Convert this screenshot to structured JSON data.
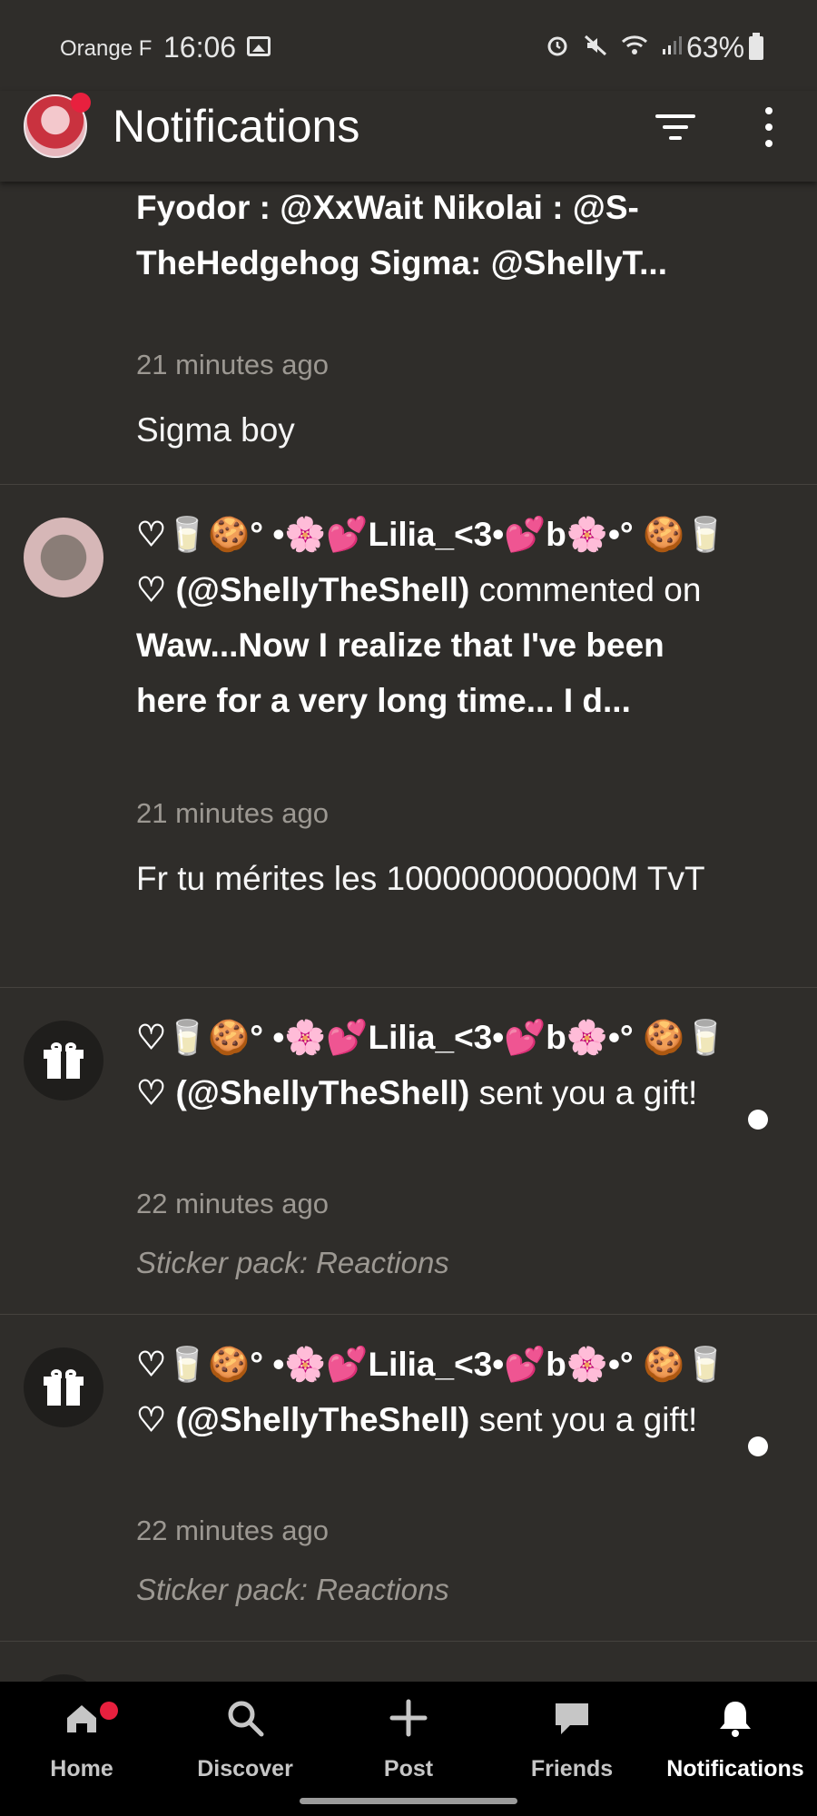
{
  "status_bar": {
    "carrier": "Orange F",
    "time": "16:06",
    "battery": "63%"
  },
  "header": {
    "title": "Notifications"
  },
  "notifications": [
    {
      "headline_bold": "Fyodor : @XxWait Nikolai : @S-TheHedgehog Sigma: @ShellyT...",
      "time": "21 minutes ago",
      "body": "Sigma boy"
    },
    {
      "user": "♡🥛🍪° •🌸💕Lilia_<3•💕b🌸•° 🍪🥛♡ (@ShellyTheShell)",
      "action": "commented on",
      "target": "Waw...Now I realize that I've been here for a very long time... I d...",
      "time": "21 minutes ago",
      "body": "Fr tu mérites les 100000000000M TvT"
    },
    {
      "user": "♡🥛🍪° •🌸💕Lilia_<3•💕b🌸•° 🍪🥛♡ (@ShellyTheShell)",
      "action": "sent you a gift!",
      "time": "22 minutes ago",
      "sticker": "Sticker pack: Reactions"
    },
    {
      "user": "♡🥛🍪° •🌸💕Lilia_<3•💕b🌸•° 🍪🥛♡ (@ShellyTheShell)",
      "action": "sent you a gift!",
      "time": "22 minutes ago",
      "sticker": "Sticker pack: Reactions"
    }
  ],
  "nav": {
    "home": "Home",
    "discover": "Discover",
    "post": "Post",
    "friends": "Friends",
    "notifications": "Notifications"
  },
  "colors": {
    "background": "#2f2d2a",
    "nav_background": "#000000",
    "badge": "#e8203e",
    "muted_text": "#9c9892"
  }
}
